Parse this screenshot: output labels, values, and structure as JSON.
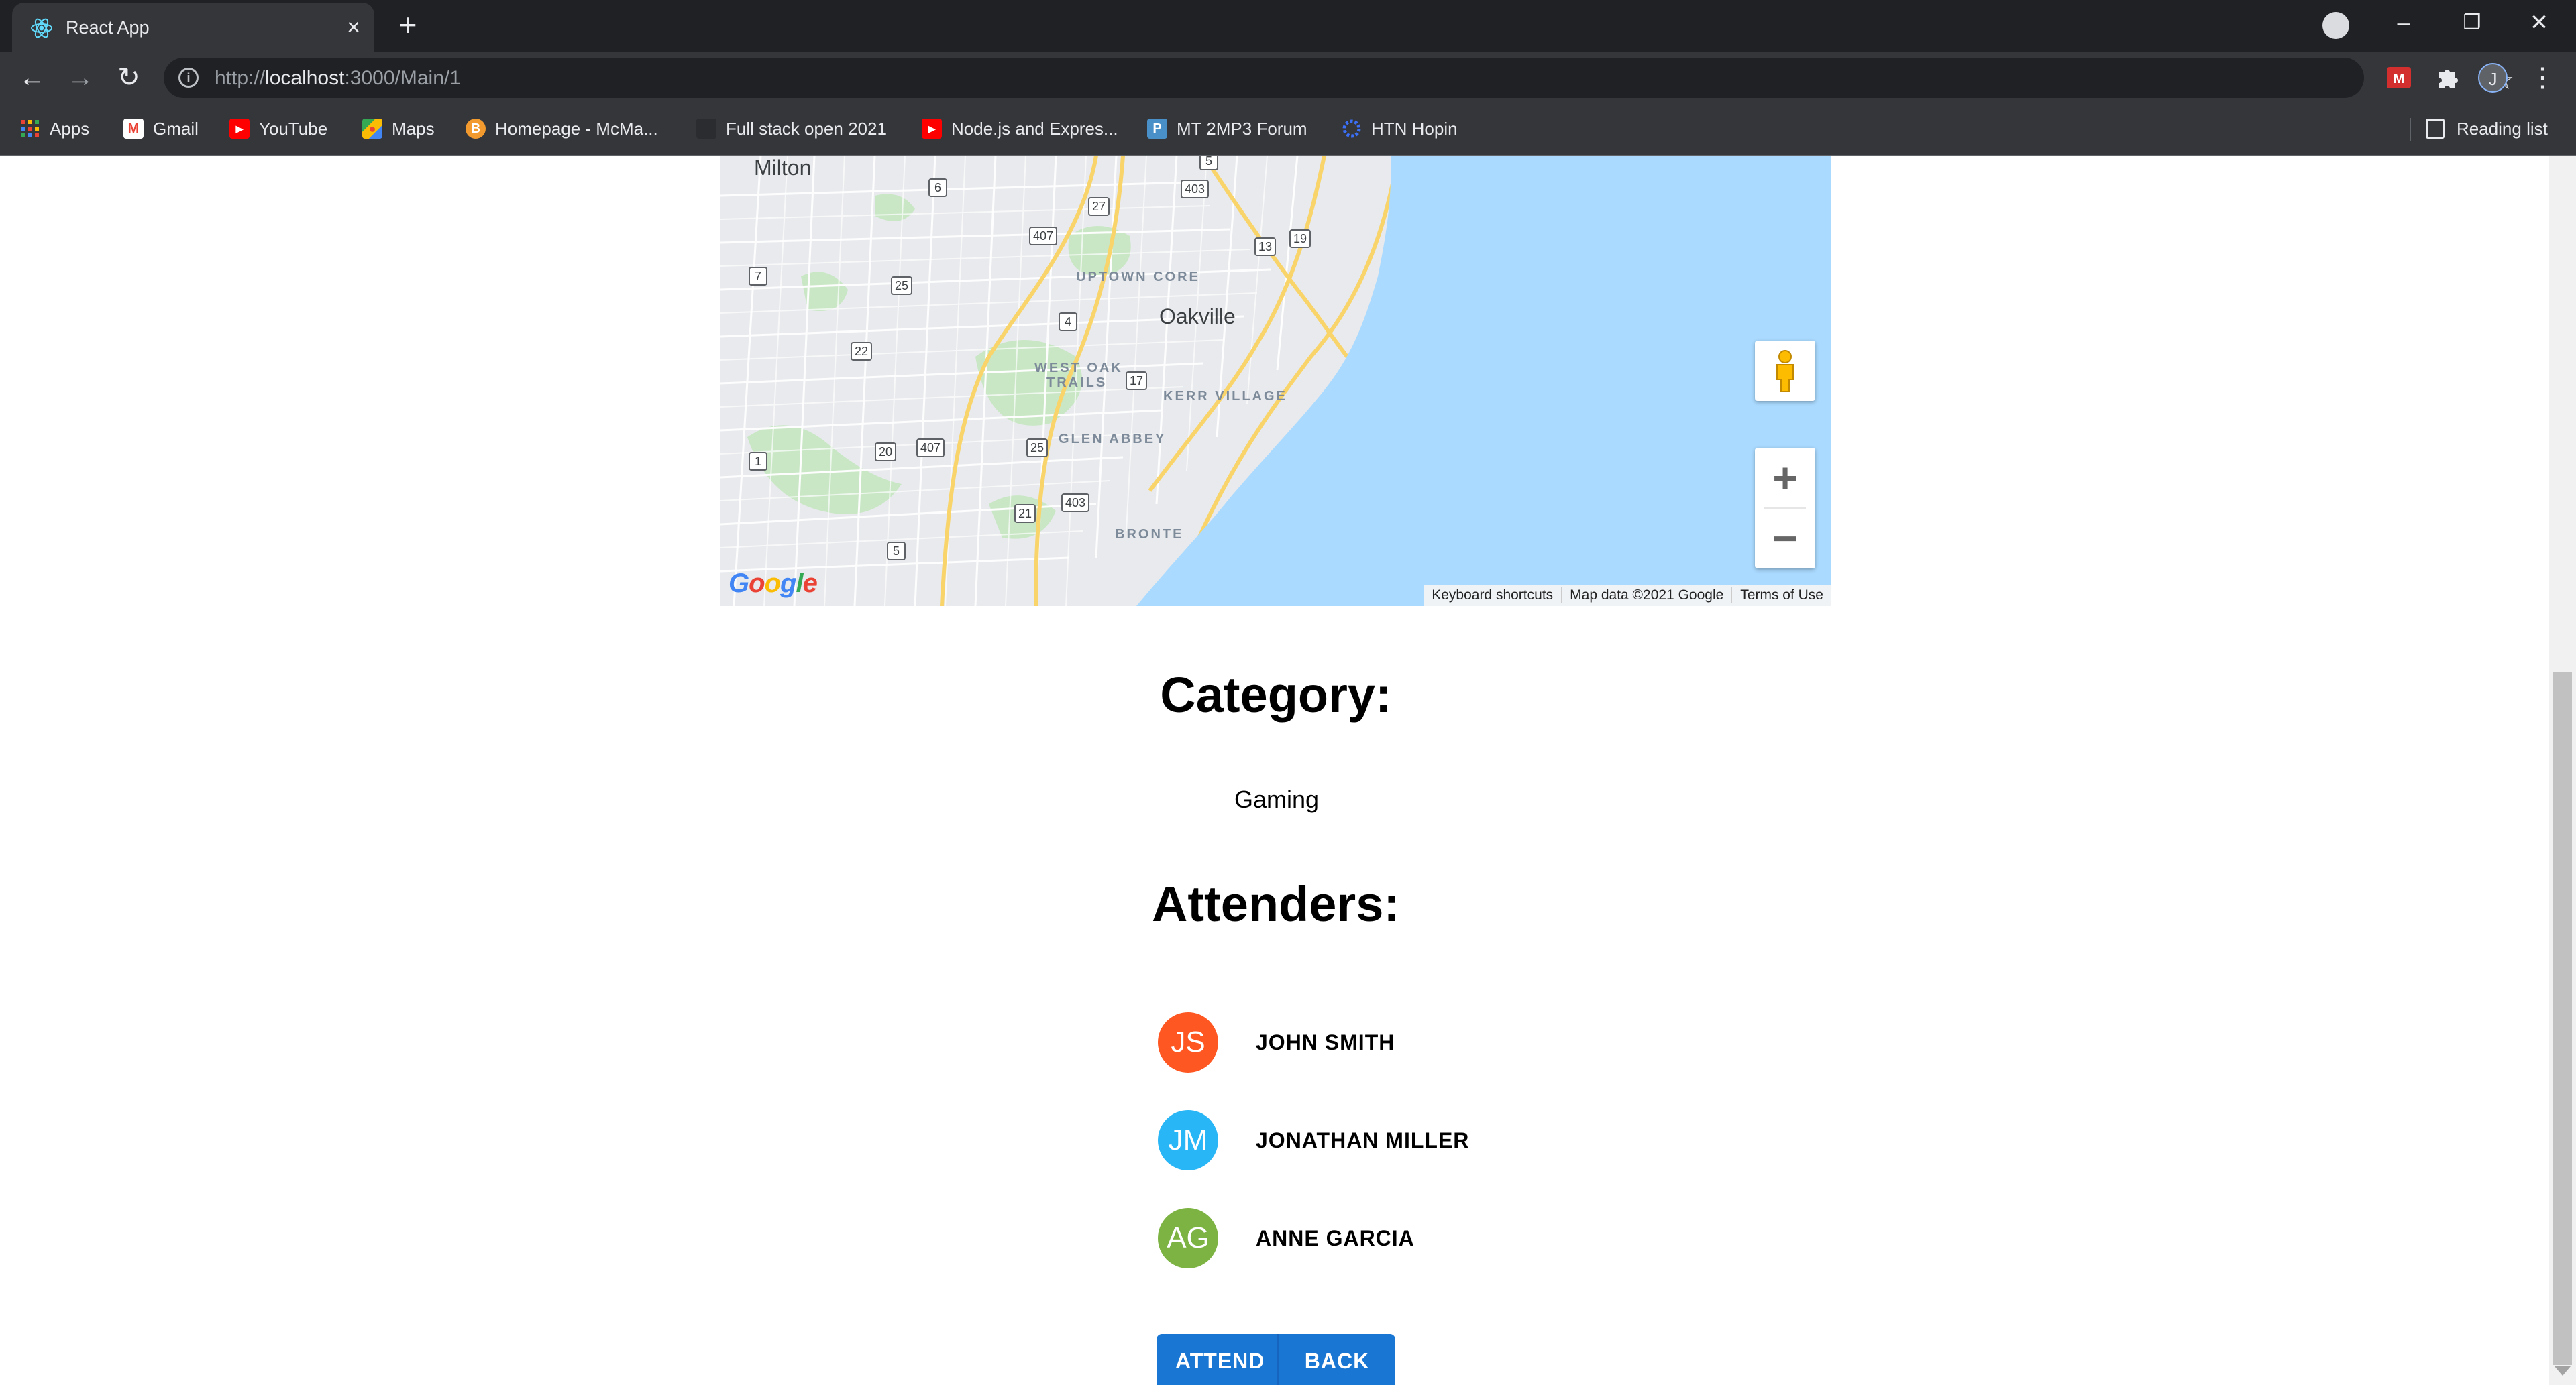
{
  "browser": {
    "tab_title": "React App",
    "url_scheme": "http://",
    "url_host": "localhost",
    "url_path": ":3000/Main/1",
    "profile_initial": "J",
    "bookmarks": [
      {
        "label": "Apps",
        "icon": "apps-grid-icon"
      },
      {
        "label": "Gmail",
        "icon": "gmail-icon"
      },
      {
        "label": "YouTube",
        "icon": "youtube-icon"
      },
      {
        "label": "Maps",
        "icon": "maps-icon"
      },
      {
        "label": "Homepage - McMa...",
        "icon": "mcmaster-icon"
      },
      {
        "label": "Full stack open 2021",
        "icon": "fullstack-icon"
      },
      {
        "label": "Node.js and Expres...",
        "icon": "youtube-icon"
      },
      {
        "label": "MT 2MP3 Forum",
        "icon": "piazza-icon"
      },
      {
        "label": "HTN Hopin",
        "icon": "hopin-icon"
      }
    ],
    "reading_list": "Reading list"
  },
  "map": {
    "towns": {
      "milton": "Milton",
      "oakville": "Oakville"
    },
    "districts": {
      "uptown_core": "UPTOWN CORE",
      "west_oak_1": "WEST OAK",
      "west_oak_2": "TRAILS",
      "kerr_village": "KERR VILLAGE",
      "glen_abbey": "GLEN ABBEY",
      "bronte": "BRONTE"
    },
    "shields": [
      "5",
      "6",
      "27",
      "403",
      "407",
      "13",
      "19",
      "7",
      "25",
      "4",
      "22",
      "17",
      "1",
      "20",
      "407",
      "25",
      "403",
      "21",
      "5"
    ],
    "google_logo": "Google",
    "attribution": {
      "shortcuts": "Keyboard shortcuts",
      "data": "Map data ©2021 Google",
      "terms": "Terms of Use"
    },
    "zoom_in": "+",
    "zoom_out": "−"
  },
  "event": {
    "category_heading": "Category:",
    "category_value": "Gaming",
    "attenders_heading": "Attenders:",
    "attenders": [
      {
        "initials": "JS",
        "name": "JOHN SMITH",
        "color": "#ff5722"
      },
      {
        "initials": "JM",
        "name": "JONATHAN MILLER",
        "color": "#29b6f6"
      },
      {
        "initials": "AG",
        "name": "ANNE GARCIA",
        "color": "#7cb342"
      }
    ],
    "attend_label": "ATTEND",
    "back_label": "BACK"
  },
  "colors": {
    "primary_button": "#1976d2",
    "chrome_dark": "#202124",
    "chrome_toolbar": "#35363a",
    "water": "#aadaff"
  }
}
